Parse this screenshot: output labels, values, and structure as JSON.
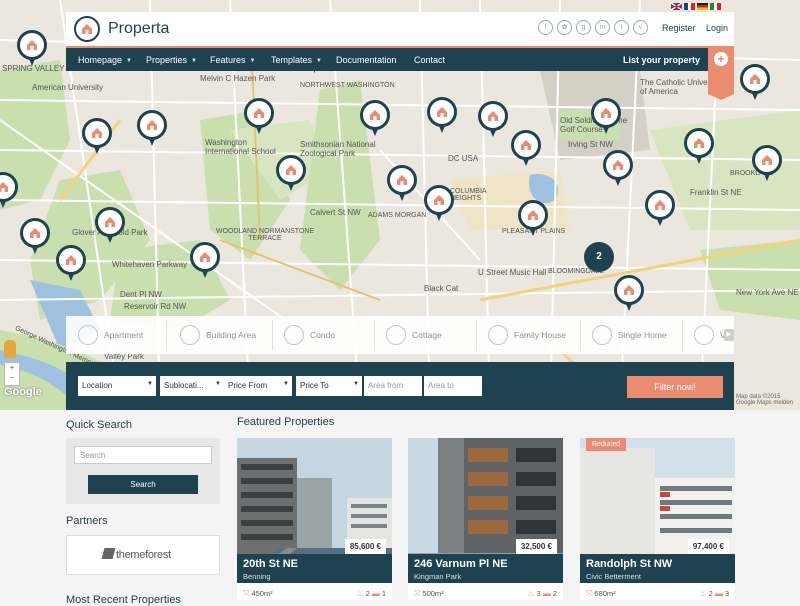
{
  "header": {
    "brand": "Properta",
    "register": "Register",
    "login": "Login",
    "socials": [
      "f",
      "✿",
      "g",
      "in",
      "t",
      "v"
    ]
  },
  "nav": {
    "items": [
      "Homepage",
      "Properties",
      "Features",
      "Templates",
      "Documentation",
      "Contact"
    ],
    "list_property": "List your property",
    "plus": "+"
  },
  "map": {
    "labels": [
      "SPRING VALLEY",
      "Properta",
      "American University",
      "Melvin C Hazen Park",
      "NORTHWEST WASHINGTON",
      "The Catholic University of America",
      "Washington International School",
      "Smithsonian National Zoological Park",
      "Old Soldiers Home Golf Course",
      "DC USA",
      "COLUMBIA HEIGHTS",
      "Irving St NW",
      "Calvert St NW",
      "ADAMS MORGAN",
      "WOODLAND NORMANSTONE TERRACE",
      "BROOKLAND",
      "Franklin St NE",
      "U Street Music Hall",
      "BLOOMINGDALE",
      "Whitehaven Parkway",
      "Glover Archbold Park",
      "Dent Pl NW",
      "Reservoir Rd NW",
      "Black Cat",
      "New York Ave NE",
      "Valley Park",
      "George Washington Memorial Pkwy",
      "PLEASANT PLAINS"
    ],
    "cluster_count": "2",
    "google": "Google",
    "map_data": "Map data ©2015 Google Maps melden"
  },
  "categories": [
    "Apartment",
    "Building Area",
    "Condo",
    "Cottage",
    "Family House",
    "Single Home",
    "V"
  ],
  "filters": {
    "location": "Location",
    "sublocation": "Sublocati...",
    "price_from": "Price From",
    "price_to": "Price To",
    "area_from": "Area from",
    "area_to": "Area to",
    "button": "Filter now!"
  },
  "quick_search": {
    "title": "Quick Search",
    "placeholder": "Search",
    "button": "Search"
  },
  "partners": {
    "title": "Partners",
    "logo_text": "themeforest"
  },
  "recent": {
    "title": "Most Recent Properties"
  },
  "featured": {
    "title": "Featured Properties",
    "cards": [
      {
        "name": "20th St NE",
        "location": "Benning",
        "price": "85,600 €",
        "area": "450m²",
        "beds": "2",
        "baths": "1",
        "badge": ""
      },
      {
        "name": "246 Varnum Pl NE",
        "location": "Kingman Park",
        "price": "32,500 €",
        "area": "500m²",
        "beds": "3",
        "baths": "2",
        "badge": ""
      },
      {
        "name": "Randolph St NW",
        "location": "Civic Betterment",
        "price": "97,400 €",
        "area": "680m²",
        "beds": "2",
        "baths": "3",
        "badge": "Reduced"
      }
    ]
  },
  "colors": {
    "primary": "#1f4250",
    "accent": "#e98c6f"
  }
}
